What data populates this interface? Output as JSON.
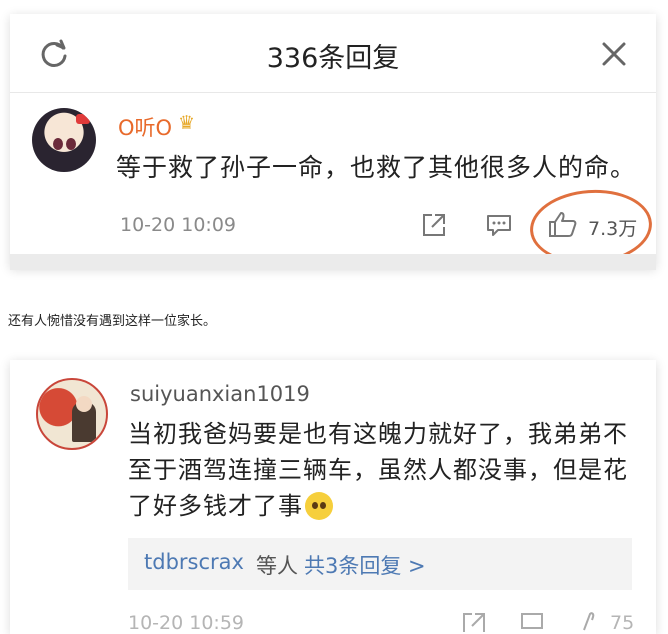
{
  "card1": {
    "header_title": "336条回复",
    "refresh_icon": "refresh-icon",
    "close_icon": "close-icon",
    "comment": {
      "username": "O听O",
      "badge_icon": "crown-icon",
      "text": "等于救了孙子一命，也救了其他很多人的命。",
      "timestamp": "10-20 10:09",
      "like_count": "7.3万",
      "icons": [
        "share-icon",
        "comment-icon",
        "like-icon"
      ]
    },
    "highlight_color": "#e0703e"
  },
  "caption": "还有人惋惜没有遇到这样一位家长。",
  "card2": {
    "comment": {
      "username": "suiyuanxian1019",
      "text": "当初我爸妈要是也有这魄力就好了，我弟弟不至于酒驾连撞三辆车，虽然人都没事，但是花了好多钱才了事",
      "emoji_icon": "tearful-emoji-icon",
      "replies": {
        "names": "tdbrscrax",
        "middle": "等人",
        "more": "共3条回复 >"
      },
      "timestamp": "10-20 10:59",
      "like_count": "75"
    }
  },
  "colors": {
    "username_orange": "#e86a2b",
    "link_blue": "#4d79b3"
  }
}
